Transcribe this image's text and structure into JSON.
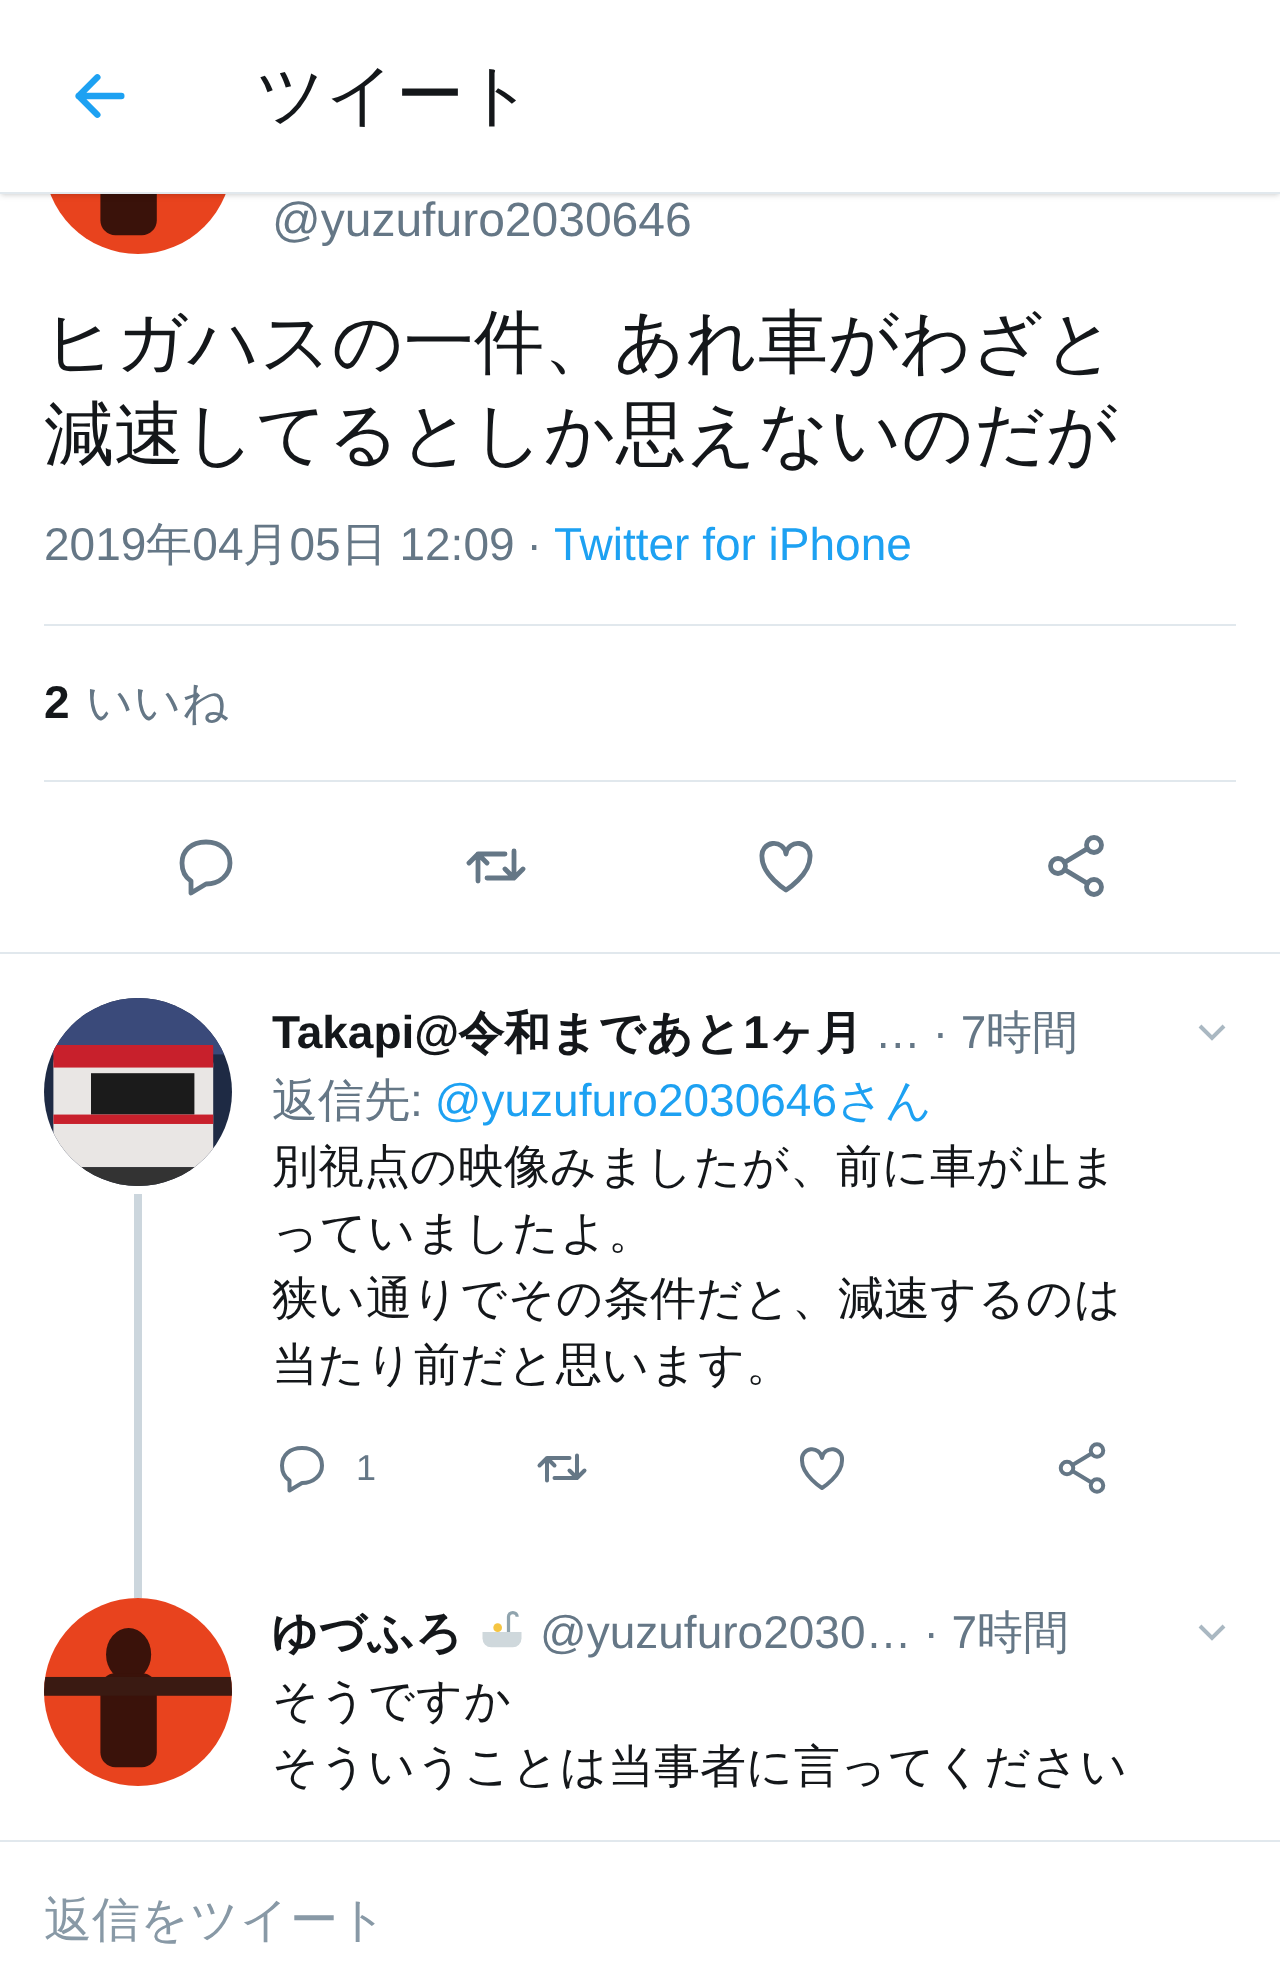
{
  "header": {
    "title": "ツイート"
  },
  "tweet": {
    "handle": "@yuzufuro2030646",
    "lines": [
      "ヒガハスの一件、あれ車がわざと",
      "減速してるとしか思えないのだが"
    ],
    "timestamp": "2019年04月05日 12:09",
    "separator": "·",
    "source": "Twitter for iPhone",
    "likes": {
      "count": "2",
      "label": "いいね"
    }
  },
  "replies": [
    {
      "kind": "train",
      "name": "Takapi@令和まであと1ヶ月",
      "handle": "…",
      "time": "· 7時間",
      "reply_to_label": "返信先:",
      "reply_to": "@yuzufuro2030646さん",
      "lines": [
        "別視点の映像みましたが、前に車が止ま",
        "っていましたよ。",
        "狭い通りでその条件だと、減速するのは",
        "当たり前だと思います。"
      ],
      "reply_count": "1",
      "thread": true
    },
    {
      "kind": "shadow",
      "name": "ゆづふろ",
      "handle": "@yuzufuro2030…",
      "time": "· 7時間",
      "lines": [
        "そうですか",
        "そういうことは当事者に言ってください"
      ],
      "thread": false
    }
  ],
  "compose": {
    "placeholder": "返信をツイート"
  }
}
